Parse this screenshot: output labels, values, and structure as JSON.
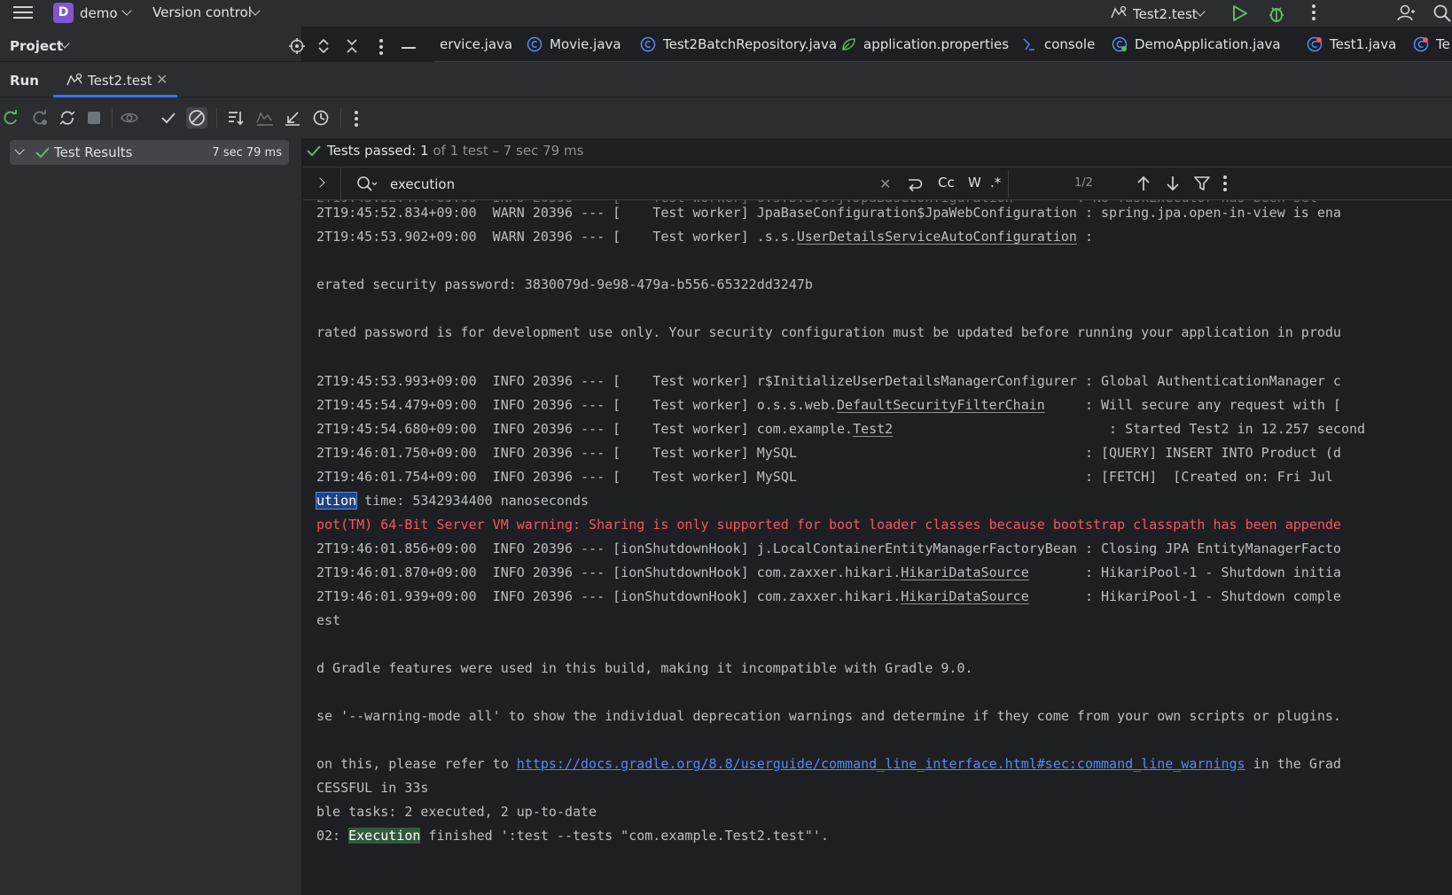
{
  "titlebar": {
    "project_initial": "D",
    "project_name": "demo",
    "version_control": "Version control",
    "run_config": "Test2.test"
  },
  "project_panel": {
    "label": "Project"
  },
  "editor_tabs": [
    {
      "label": "ervice.java"
    },
    {
      "label": "Movie.java"
    },
    {
      "label": "Test2BatchRepository.java"
    },
    {
      "label": "application.properties"
    },
    {
      "label": "console"
    },
    {
      "label": "DemoApplication.java"
    },
    {
      "label": "Test1.java"
    },
    {
      "label": "Te"
    }
  ],
  "run_window": {
    "label": "Run",
    "tab_label": "Test2.test"
  },
  "test_tree": {
    "root_label": "Test Results",
    "root_time": "7 sec 79 ms"
  },
  "status": {
    "passed": "Tests passed: 1",
    "detail": " of 1 test – 7 sec 79 ms"
  },
  "search": {
    "value": "execution",
    "match_case": "Cc",
    "words": "W",
    "regex": ".*",
    "count": "1/2"
  },
  "console": {
    "line_0": "2T19:45:52.834+09:00  WARN 20396 --- [    Test worker] JpaBaseConfiguration$JpaWebConfiguration : spring.jpa.open-in-view is ena",
    "line_1a": "2T19:45:53.902+09:00  WARN 20396 --- [    Test worker] .s.s.",
    "line_1b": "UserDetailsServiceAutoConfiguration",
    "line_1c": " :",
    "line_2": "erated security password: 3830079d-9e98-479a-b556-65322dd3247b",
    "line_3": "rated password is for development use only. Your security configuration must be updated before running your application in produ",
    "line_4": "2T19:45:53.993+09:00  INFO 20396 --- [    Test worker] r$InitializeUserDetailsManagerConfigurer : Global AuthenticationManager c",
    "line_5a": "2T19:45:54.479+09:00  INFO 20396 --- [    Test worker] o.s.s.web.",
    "line_5b": "DefaultSecurityFilterChain",
    "line_5c": "     : Will secure any request with [",
    "line_6a": "2T19:45:54.680+09:00  INFO 20396 --- [    Test worker] com.example.",
    "line_6b": "Test2",
    "line_6c": "                           : Started Test2 in 12.257 second",
    "line_7": "2T19:46:01.750+09:00  INFO 20396 --- [    Test worker] MySQL                                    : [QUERY] INSERT INTO Product (d",
    "line_8": "2T19:46:01.754+09:00  INFO 20396 --- [    Test worker] MySQL                                    : [FETCH]  [Created on: Fri Jul",
    "line_9a": "ution",
    "line_9b": " time: 5342934400 nanoseconds",
    "line_10": "pot(TM) 64-Bit Server VM warning: Sharing is only supported for boot loader classes because bootstrap classpath has been appende",
    "line_11": "2T19:46:01.856+09:00  INFO 20396 --- [ionShutdownHook] j.LocalContainerEntityManagerFactoryBean : Closing JPA EntityManagerFacto",
    "line_12a": "2T19:46:01.870+09:00  INFO 20396 --- [ionShutdownHook] com.zaxxer.hikari.",
    "line_12b": "HikariDataSource",
    "line_12c": "       : HikariPool-1 - Shutdown initia",
    "line_13a": "2T19:46:01.939+09:00  INFO 20396 --- [ionShutdownHook] com.zaxxer.hikari.",
    "line_13b": "HikariDataSource",
    "line_13c": "       : HikariPool-1 - Shutdown comple",
    "line_14": "est",
    "line_15": "d Gradle features were used in this build, making it incompatible with Gradle 9.0.",
    "line_16": "se '--warning-mode all' to show the individual deprecation warnings and determine if they come from your own scripts or plugins.",
    "line_17a": "on this, please refer to ",
    "line_17b": "https://docs.gradle.org/8.8/userguide/command_line_interface.html#sec:command_line_warnings",
    "line_17c": " in the Grad",
    "line_18": "CESSFUL in 33s",
    "line_19": "ble tasks: 2 executed, 2 up-to-date",
    "line_20a": "02: ",
    "line_20b": "Execution",
    "line_20c": " finished ':test --tests \"com.example.Test2.test\"'."
  },
  "colors": {
    "accent": "#3574f0",
    "pass_green": "#5fb865",
    "error_red": "#f75464",
    "link_blue": "#548af7",
    "project_avatar": "#8256d0"
  }
}
